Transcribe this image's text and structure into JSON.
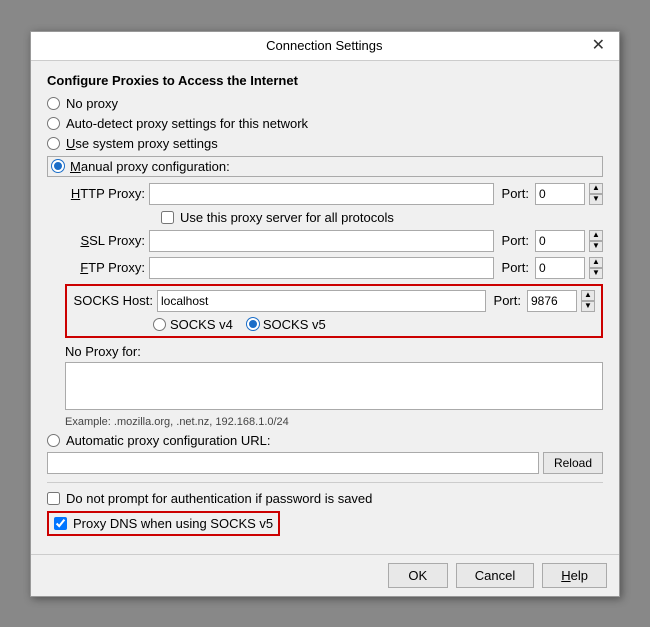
{
  "dialog": {
    "title": "Connection Settings",
    "close_icon": "✕"
  },
  "section": {
    "heading": "Configure Proxies to Access the Internet"
  },
  "proxy_options": {
    "no_proxy": "No proxy",
    "auto_detect": "Auto-detect proxy settings for this network",
    "use_system": "Use system proxy settings",
    "manual": "Manual proxy configuration:"
  },
  "fields": {
    "http_proxy_label": "HTTP Proxy:",
    "http_proxy_value": "",
    "http_proxy_port_label": "Port:",
    "http_proxy_port_value": "0",
    "use_for_all": "Use this proxy server for all protocols",
    "ssl_proxy_label": "SSL Proxy:",
    "ssl_proxy_value": "",
    "ssl_proxy_port_label": "Port:",
    "ssl_proxy_port_value": "0",
    "ftp_proxy_label": "FTP Proxy:",
    "ftp_proxy_value": "",
    "ftp_proxy_port_label": "Port:",
    "ftp_proxy_port_value": "0",
    "socks_host_label": "SOCKS Host:",
    "socks_host_value": "localhost",
    "socks_port_label": "Port:",
    "socks_port_value": "9876",
    "socks_v4_label": "SOCKS v4",
    "socks_v5_label": "SOCKS v5",
    "no_proxy_label": "No Proxy for:",
    "no_proxy_value": "",
    "example_text": "Example: .mozilla.org, .net.nz, 192.168.1.0/24",
    "auto_proxy_label": "Automatic proxy configuration URL:",
    "auto_proxy_value": "",
    "reload_label": "Reload",
    "no_auth_prompt": "Do not prompt for authentication if password is saved",
    "proxy_dns": "Proxy DNS when using SOCKS v5"
  },
  "buttons": {
    "ok": "OK",
    "cancel": "Cancel",
    "help": "Help"
  }
}
